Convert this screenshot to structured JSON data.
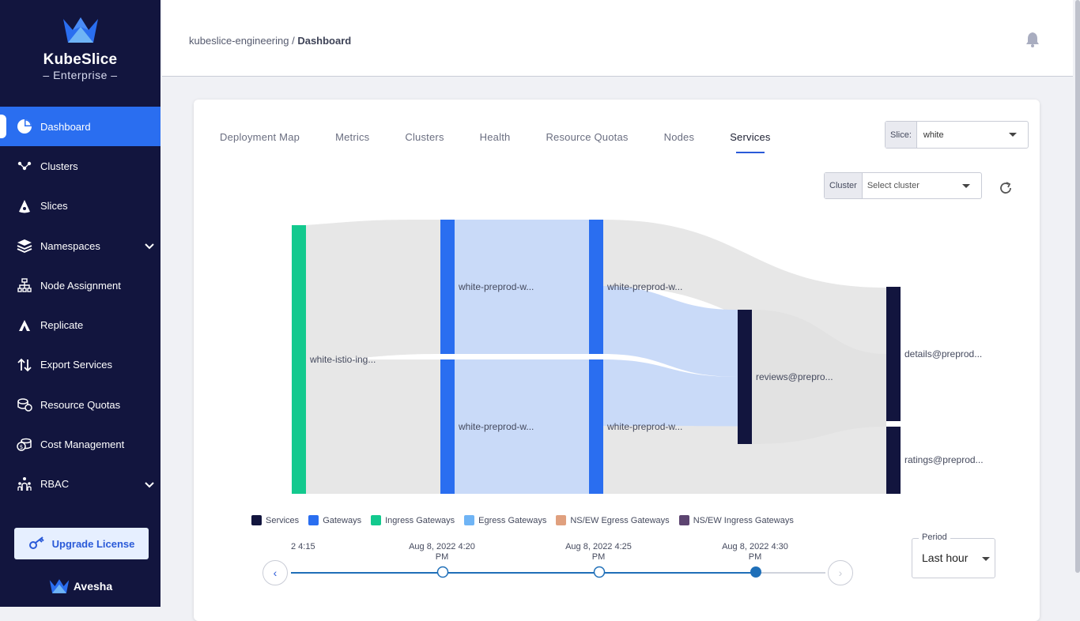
{
  "brand": {
    "name": "KubeSlice",
    "edition": "Enterprise",
    "vendor": "Avesha"
  },
  "breadcrumb": {
    "workspace": "kubeslice-engineering",
    "separator": " / ",
    "page": "Dashboard"
  },
  "sidebar": {
    "items": [
      {
        "label": "Dashboard",
        "icon": "pie-chart-icon",
        "active": true
      },
      {
        "label": "Clusters",
        "icon": "cluster-nodes-icon"
      },
      {
        "label": "Slices",
        "icon": "slice-icon"
      },
      {
        "label": "Namespaces",
        "icon": "layers-icon",
        "expandable": true
      },
      {
        "label": "Node Assignment",
        "icon": "hierarchy-icon"
      },
      {
        "label": "Replicate",
        "icon": "replicate-icon"
      },
      {
        "label": "Export Services",
        "icon": "arrows-updown-icon"
      },
      {
        "label": "Resource Quotas",
        "icon": "quota-icon"
      },
      {
        "label": "Cost Management",
        "icon": "coins-icon"
      },
      {
        "label": "RBAC",
        "icon": "rbac-icon",
        "expandable": true
      }
    ],
    "upgrade_label": "Upgrade License"
  },
  "tabs": [
    "Deployment Map",
    "Metrics",
    "Clusters",
    "Health",
    "Resource Quotas",
    "Nodes",
    "Services"
  ],
  "active_tab": "Services",
  "slice_select": {
    "label": "Slice:",
    "value": "white"
  },
  "cluster_select": {
    "label": "Cluster",
    "placeholder": "Select cluster"
  },
  "sankey": {
    "nodes": [
      {
        "label": "white-istio-ing...",
        "type": "Ingress Gateways"
      },
      {
        "label": "white-preprod-w...",
        "type": "Gateways"
      },
      {
        "label": "white-preprod-w...",
        "type": "Gateways"
      },
      {
        "label": "white-preprod-w...",
        "type": "Gateways"
      },
      {
        "label": "white-preprod-w...",
        "type": "Gateways"
      },
      {
        "label": "reviews@prepro...",
        "type": "Services"
      },
      {
        "label": "details@preprod...",
        "type": "Services"
      },
      {
        "label": "ratings@preprod...",
        "type": "Services"
      }
    ]
  },
  "legend": [
    {
      "label": "Services",
      "color": "#12153e"
    },
    {
      "label": "Gateways",
      "color": "#2a6ef0"
    },
    {
      "label": "Ingress Gateways",
      "color": "#13c98e"
    },
    {
      "label": "Egress Gateways",
      "color": "#6fb4f5"
    },
    {
      "label": "NS/EW Egress Gateways",
      "color": "#e0a07e"
    },
    {
      "label": "NS/EW Ingress Gateways",
      "color": "#5c4470"
    }
  ],
  "timeline": {
    "partial": "2 4:15",
    "points": [
      {
        "line1": "Aug 8, 2022 4:20",
        "line2": "PM"
      },
      {
        "line1": "Aug 8, 2022 4:25",
        "line2": "PM"
      },
      {
        "line1": "Aug 8, 2022 4:30",
        "line2": "PM"
      }
    ]
  },
  "period": {
    "label": "Period",
    "value": "Last hour"
  }
}
